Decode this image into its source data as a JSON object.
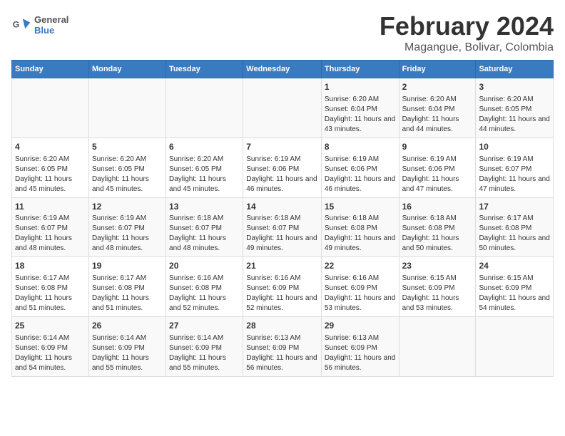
{
  "header": {
    "logo_general": "General",
    "logo_blue": "Blue",
    "title": "February 2024",
    "subtitle": "Magangue, Bolivar, Colombia"
  },
  "days_of_week": [
    "Sunday",
    "Monday",
    "Tuesday",
    "Wednesday",
    "Thursday",
    "Friday",
    "Saturday"
  ],
  "weeks": [
    [
      {
        "day": "",
        "info": ""
      },
      {
        "day": "",
        "info": ""
      },
      {
        "day": "",
        "info": ""
      },
      {
        "day": "",
        "info": ""
      },
      {
        "day": "1",
        "info": "Sunrise: 6:20 AM\nSunset: 6:04 PM\nDaylight: 11 hours and 43 minutes."
      },
      {
        "day": "2",
        "info": "Sunrise: 6:20 AM\nSunset: 6:04 PM\nDaylight: 11 hours and 44 minutes."
      },
      {
        "day": "3",
        "info": "Sunrise: 6:20 AM\nSunset: 6:05 PM\nDaylight: 11 hours and 44 minutes."
      }
    ],
    [
      {
        "day": "4",
        "info": "Sunrise: 6:20 AM\nSunset: 6:05 PM\nDaylight: 11 hours and 45 minutes."
      },
      {
        "day": "5",
        "info": "Sunrise: 6:20 AM\nSunset: 6:05 PM\nDaylight: 11 hours and 45 minutes."
      },
      {
        "day": "6",
        "info": "Sunrise: 6:20 AM\nSunset: 6:05 PM\nDaylight: 11 hours and 45 minutes."
      },
      {
        "day": "7",
        "info": "Sunrise: 6:19 AM\nSunset: 6:06 PM\nDaylight: 11 hours and 46 minutes."
      },
      {
        "day": "8",
        "info": "Sunrise: 6:19 AM\nSunset: 6:06 PM\nDaylight: 11 hours and 46 minutes."
      },
      {
        "day": "9",
        "info": "Sunrise: 6:19 AM\nSunset: 6:06 PM\nDaylight: 11 hours and 47 minutes."
      },
      {
        "day": "10",
        "info": "Sunrise: 6:19 AM\nSunset: 6:07 PM\nDaylight: 11 hours and 47 minutes."
      }
    ],
    [
      {
        "day": "11",
        "info": "Sunrise: 6:19 AM\nSunset: 6:07 PM\nDaylight: 11 hours and 48 minutes."
      },
      {
        "day": "12",
        "info": "Sunrise: 6:19 AM\nSunset: 6:07 PM\nDaylight: 11 hours and 48 minutes."
      },
      {
        "day": "13",
        "info": "Sunrise: 6:18 AM\nSunset: 6:07 PM\nDaylight: 11 hours and 48 minutes."
      },
      {
        "day": "14",
        "info": "Sunrise: 6:18 AM\nSunset: 6:07 PM\nDaylight: 11 hours and 49 minutes."
      },
      {
        "day": "15",
        "info": "Sunrise: 6:18 AM\nSunset: 6:08 PM\nDaylight: 11 hours and 49 minutes."
      },
      {
        "day": "16",
        "info": "Sunrise: 6:18 AM\nSunset: 6:08 PM\nDaylight: 11 hours and 50 minutes."
      },
      {
        "day": "17",
        "info": "Sunrise: 6:17 AM\nSunset: 6:08 PM\nDaylight: 11 hours and 50 minutes."
      }
    ],
    [
      {
        "day": "18",
        "info": "Sunrise: 6:17 AM\nSunset: 6:08 PM\nDaylight: 11 hours and 51 minutes."
      },
      {
        "day": "19",
        "info": "Sunrise: 6:17 AM\nSunset: 6:08 PM\nDaylight: 11 hours and 51 minutes."
      },
      {
        "day": "20",
        "info": "Sunrise: 6:16 AM\nSunset: 6:08 PM\nDaylight: 11 hours and 52 minutes."
      },
      {
        "day": "21",
        "info": "Sunrise: 6:16 AM\nSunset: 6:09 PM\nDaylight: 11 hours and 52 minutes."
      },
      {
        "day": "22",
        "info": "Sunrise: 6:16 AM\nSunset: 6:09 PM\nDaylight: 11 hours and 53 minutes."
      },
      {
        "day": "23",
        "info": "Sunrise: 6:15 AM\nSunset: 6:09 PM\nDaylight: 11 hours and 53 minutes."
      },
      {
        "day": "24",
        "info": "Sunrise: 6:15 AM\nSunset: 6:09 PM\nDaylight: 11 hours and 54 minutes."
      }
    ],
    [
      {
        "day": "25",
        "info": "Sunrise: 6:14 AM\nSunset: 6:09 PM\nDaylight: 11 hours and 54 minutes."
      },
      {
        "day": "26",
        "info": "Sunrise: 6:14 AM\nSunset: 6:09 PM\nDaylight: 11 hours and 55 minutes."
      },
      {
        "day": "27",
        "info": "Sunrise: 6:14 AM\nSunset: 6:09 PM\nDaylight: 11 hours and 55 minutes."
      },
      {
        "day": "28",
        "info": "Sunrise: 6:13 AM\nSunset: 6:09 PM\nDaylight: 11 hours and 56 minutes."
      },
      {
        "day": "29",
        "info": "Sunrise: 6:13 AM\nSunset: 6:09 PM\nDaylight: 11 hours and 56 minutes."
      },
      {
        "day": "",
        "info": ""
      },
      {
        "day": "",
        "info": ""
      }
    ]
  ]
}
